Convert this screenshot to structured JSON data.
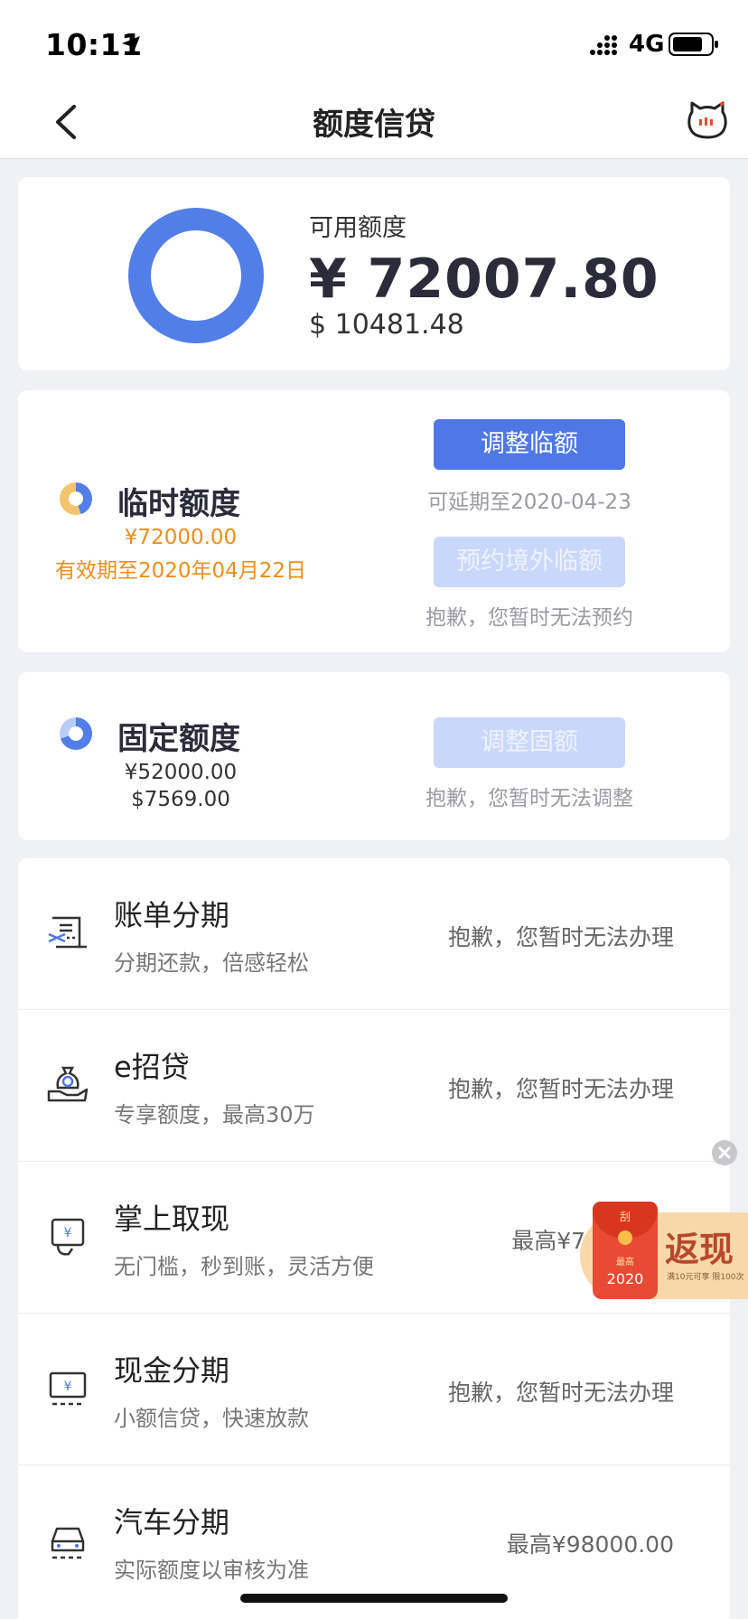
{
  "status": {
    "time": "10:11",
    "network": "4G"
  },
  "nav": {
    "title": "额度信贷"
  },
  "summary": {
    "label": "可用额度",
    "cny": "¥ 72007.80",
    "usd": "$ 10481.48"
  },
  "temp_quota": {
    "title": "临时额度",
    "amount": "¥72000.00",
    "validity": "有效期至2020年04月22日",
    "adjust_button": "调整临额",
    "adjust_note": "可延期至2020-04-23",
    "reserve_button": "预约境外临额",
    "reserve_note": "抱歉，您暂时无法预约"
  },
  "fixed_quota": {
    "title": "固定额度",
    "cny": "¥52000.00",
    "usd": "$7569.00",
    "adjust_button": "调整固额",
    "adjust_note": "抱歉，您暂时无法调整"
  },
  "services": [
    {
      "icon": "bill-installment-icon",
      "title": "账单分期",
      "subtitle": "分期还款，倍感轻松",
      "status": "抱歉，您暂时无法办理"
    },
    {
      "icon": "money-bag-hand-icon",
      "title": "e招贷",
      "subtitle": "专享额度，最高30万",
      "status": "抱歉，您暂时无法办理"
    },
    {
      "icon": "handheld-cash-icon",
      "title": "掌上取现",
      "subtitle": "无门槛，秒到账，灵活方便",
      "status": "最高¥7"
    },
    {
      "icon": "cash-monitor-icon",
      "title": "现金分期",
      "subtitle": "小额信贷，快速放款",
      "status": "抱歉，您暂时无法办理"
    },
    {
      "icon": "car-icon",
      "title": "汽车分期",
      "subtitle": "实际额度以审核为准",
      "status": "最高¥98000.00"
    }
  ],
  "promo": {
    "scratch": "刮",
    "max": "最高",
    "year": "2020",
    "headline": "返现",
    "fine_print": "满10元可享 限100次"
  },
  "colors": {
    "primary": "#4f78e6",
    "disabled": "#c9d7fa",
    "orange": "#ee8e1c",
    "background": "#f0f1f5"
  }
}
